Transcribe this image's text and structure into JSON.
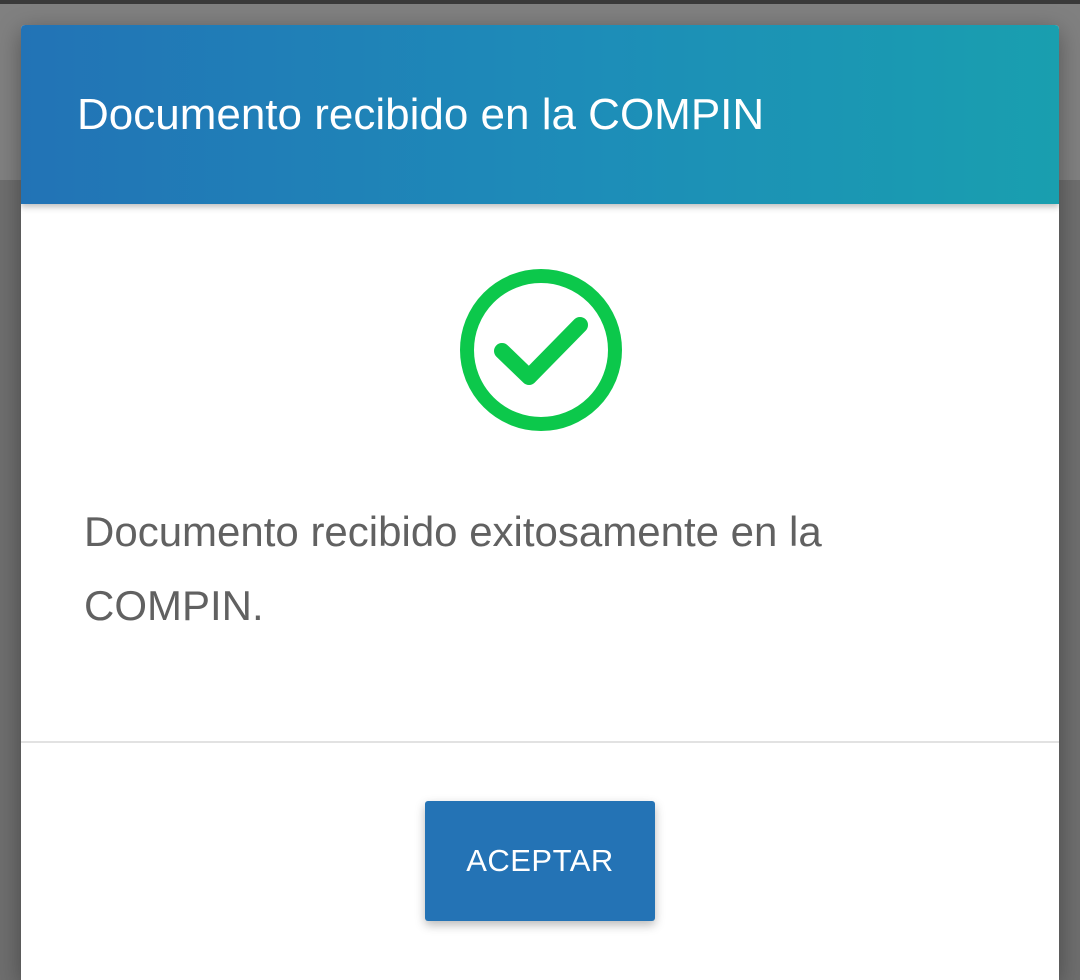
{
  "dialog": {
    "title": "Documento recibido en la COMPIN",
    "message": "Documento recibido exitosamente en la COMPIN.",
    "icon": "check-circle-icon",
    "accept_label": "ACEPTAR"
  },
  "colors": {
    "header_gradient_start": "#2273b6",
    "header_gradient_end": "#199faf",
    "success_green": "#0cc84b",
    "button_blue": "#2473b5",
    "message_text": "#616161",
    "backdrop": "#6e6e6e"
  }
}
